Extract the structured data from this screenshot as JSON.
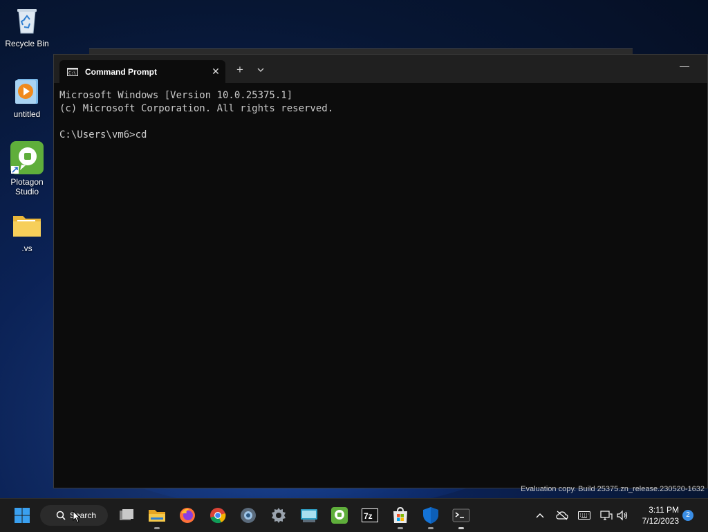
{
  "desktop": {
    "icons": [
      {
        "label": "Recycle Bin"
      },
      {
        "label": "untitled"
      },
      {
        "label": "Plotagon Studio"
      },
      {
        "label": ".vs"
      }
    ]
  },
  "terminal": {
    "tab_title": "Command Prompt",
    "lines": [
      "Microsoft Windows [Version 10.0.25375.1]",
      "(c) Microsoft Corporation. All rights reserved.",
      "",
      "C:\\Users\\vm6>cd"
    ]
  },
  "watermark": "Evaluation copy. Build 25375.zn_release.230520-1632",
  "taskbar": {
    "search_label": "Search",
    "apps": [
      "task-view",
      "file-explorer",
      "firefox",
      "chrome",
      "settings-alt",
      "settings",
      "keyboard-app",
      "plotagon",
      "7zip",
      "store",
      "defender",
      "terminal"
    ],
    "clock": {
      "time": "3:11 PM",
      "date": "7/12/2023"
    },
    "notification_count": "2"
  },
  "colors": {
    "terminal_bg": "#0c0c0c",
    "titlebar_bg": "#202020",
    "taskbar_bg": "#1c1c1c",
    "console_text": "#cccccc"
  }
}
